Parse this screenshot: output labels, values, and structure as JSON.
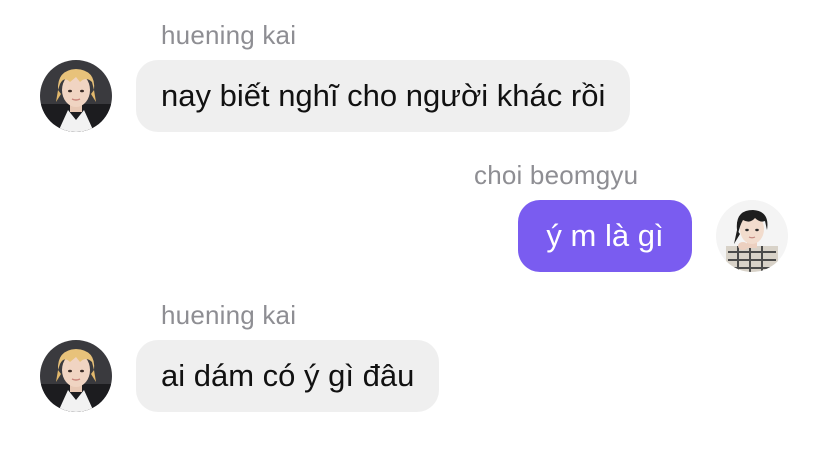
{
  "messages": [
    {
      "sender": "huening kai",
      "text": "nay biết nghĩ cho người khác rồi",
      "direction": "incoming",
      "avatar_icon": "blond-avatar-icon"
    },
    {
      "sender": "choi beomgyu",
      "text": "ý m là gì",
      "direction": "outgoing",
      "avatar_icon": "dark-hair-avatar-icon"
    },
    {
      "sender": "huening kai",
      "text": "ai dám có ý gì đâu",
      "direction": "incoming",
      "avatar_icon": "blond-avatar-icon"
    }
  ],
  "colors": {
    "incoming_bubble": "#efefef",
    "outgoing_bubble": "#7a5cf0",
    "sender_name": "#8e8e93"
  }
}
